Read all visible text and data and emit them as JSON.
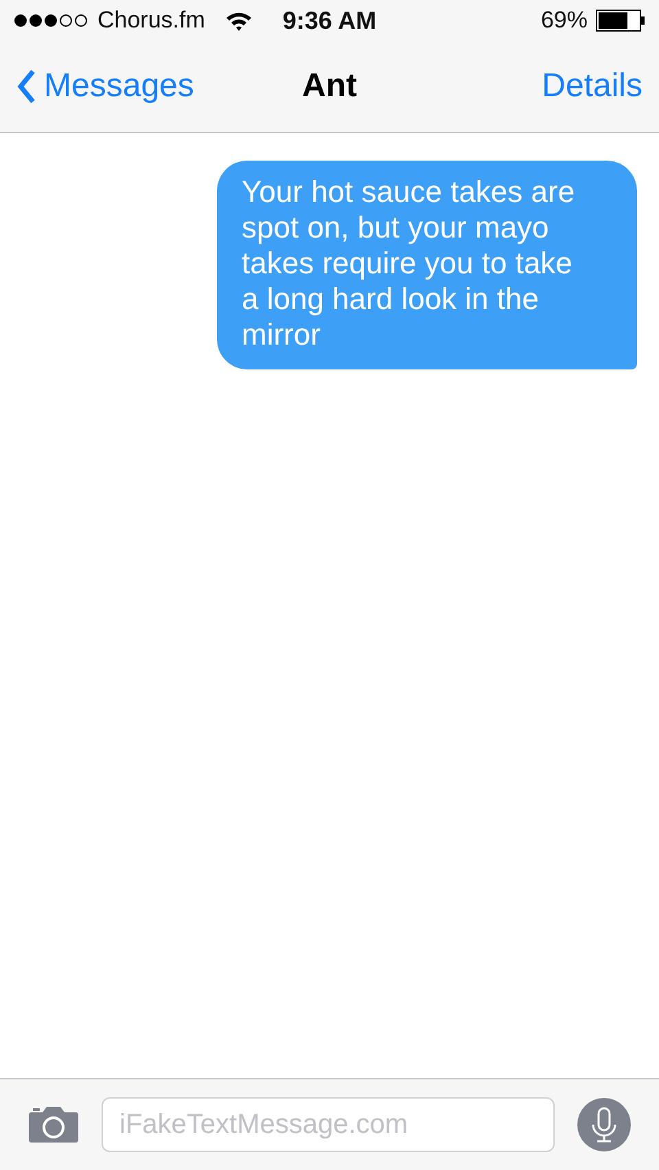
{
  "status_bar": {
    "carrier": "Chorus.fm",
    "time": "9:36 AM",
    "battery": "69%"
  },
  "nav": {
    "back": "Messages",
    "title": "Ant",
    "action": "Details"
  },
  "messages": [
    {
      "kind": "sent",
      "text": "Your hot sauce takes are spot on, but your mayo takes require you to take a long hard look in the mirror"
    }
  ],
  "composer": {
    "placeholder": "iFakeTextMessage.com"
  }
}
